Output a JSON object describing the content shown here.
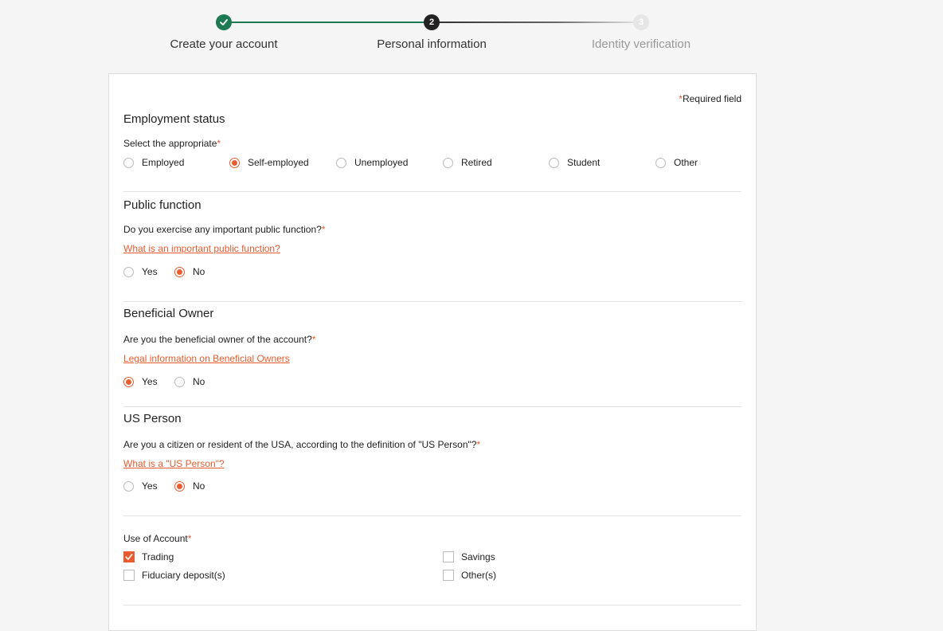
{
  "stepper": {
    "steps": [
      {
        "label": "Create your account",
        "state": "done"
      },
      {
        "label": "Personal information",
        "state": "current",
        "number": "2"
      },
      {
        "label": "Identity verification",
        "state": "pending",
        "number": "3"
      }
    ]
  },
  "form": {
    "required_note": "Required field",
    "required_marker": "*",
    "employment": {
      "title": "Employment status",
      "question": "Select the appropriate",
      "options": [
        "Employed",
        "Self-employed",
        "Unemployed",
        "Retired",
        "Student",
        "Other"
      ],
      "selected": "Self-employed"
    },
    "public_function": {
      "title": "Public function",
      "question": "Do you exercise any important public function?",
      "link": "What is an important public function?",
      "options": [
        "Yes",
        "No"
      ],
      "selected": "No"
    },
    "beneficial_owner": {
      "title": "Beneficial Owner",
      "question": "Are you the beneficial owner of the account?",
      "link": "Legal information on Beneficial Owners",
      "options": [
        "Yes",
        "No"
      ],
      "selected": "Yes"
    },
    "us_person": {
      "title": "US Person",
      "question": "Are you a citizen or resident of the USA, according to the definition of \"US Person\"?",
      "link": "What is a \"US Person\"?",
      "options": [
        "Yes",
        "No"
      ],
      "selected": "No"
    },
    "use_of_account": {
      "question": "Use of Account",
      "options": [
        {
          "label": "Trading",
          "checked": true
        },
        {
          "label": "Savings",
          "checked": false
        },
        {
          "label": "Fiduciary deposit(s)",
          "checked": false
        },
        {
          "label": "Other(s)",
          "checked": false
        }
      ]
    }
  },
  "colors": {
    "accent": "#e85c2f",
    "done": "#1e7a52"
  }
}
